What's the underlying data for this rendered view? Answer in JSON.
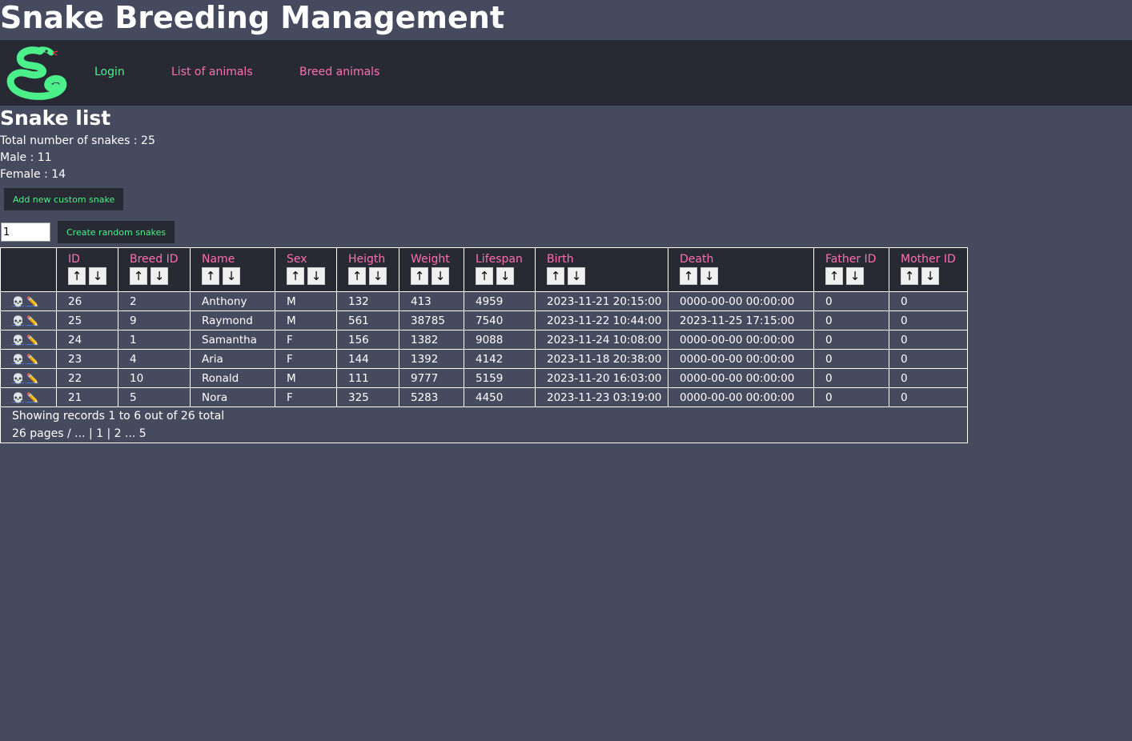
{
  "app_title": "Snake Breeding Management",
  "nav": {
    "logo_icon": "snake-logo-icon",
    "links": [
      {
        "label": "Login",
        "color": "#4cf08a"
      },
      {
        "label": "List of animals",
        "color": "#ff6fb5"
      },
      {
        "label": "Breed animals",
        "color": "#ff6fb5"
      }
    ]
  },
  "section_title": "Snake list",
  "stats": {
    "total": "Total number of snakes : 25",
    "male": "Male : 11",
    "female": "Female : 14"
  },
  "add_button_label": "Add new custom snake",
  "create": {
    "quantity_value": "1",
    "button_label": "Create random snakes"
  },
  "table": {
    "columns": [
      "ID",
      "Breed ID",
      "Name",
      "Sex",
      "Heigth",
      "Weight",
      "Lifespan",
      "Birth",
      "Death",
      "Father ID",
      "Mother ID"
    ],
    "sort_up": "↑",
    "sort_down": "↓",
    "action_icons": {
      "kill": "💀",
      "edit": "✏️"
    },
    "rows": [
      [
        "26",
        "2",
        "Anthony",
        "M",
        "132",
        "413",
        "4959",
        "2023-11-21 20:15:00",
        "0000-00-00 00:00:00",
        "0",
        "0"
      ],
      [
        "25",
        "9",
        "Raymond",
        "M",
        "561",
        "38785",
        "7540",
        "2023-11-22 10:44:00",
        "2023-11-25 17:15:00",
        "0",
        "0"
      ],
      [
        "24",
        "1",
        "Samantha",
        "F",
        "156",
        "1382",
        "9088",
        "2023-11-24 10:08:00",
        "0000-00-00 00:00:00",
        "0",
        "0"
      ],
      [
        "23",
        "4",
        "Aria",
        "F",
        "144",
        "1392",
        "4142",
        "2023-11-18 20:38:00",
        "0000-00-00 00:00:00",
        "0",
        "0"
      ],
      [
        "22",
        "10",
        "Ronald",
        "M",
        "111",
        "9777",
        "5159",
        "2023-11-20 16:03:00",
        "0000-00-00 00:00:00",
        "0",
        "0"
      ],
      [
        "21",
        "5",
        "Nora",
        "F",
        "325",
        "5283",
        "4450",
        "2023-11-23 03:19:00",
        "0000-00-00 00:00:00",
        "0",
        "0"
      ]
    ],
    "footer_records": "Showing records 1 to 6 out of 26 total",
    "footer_pages": "26 pages / ... | 1 | 2 ... 5"
  }
}
